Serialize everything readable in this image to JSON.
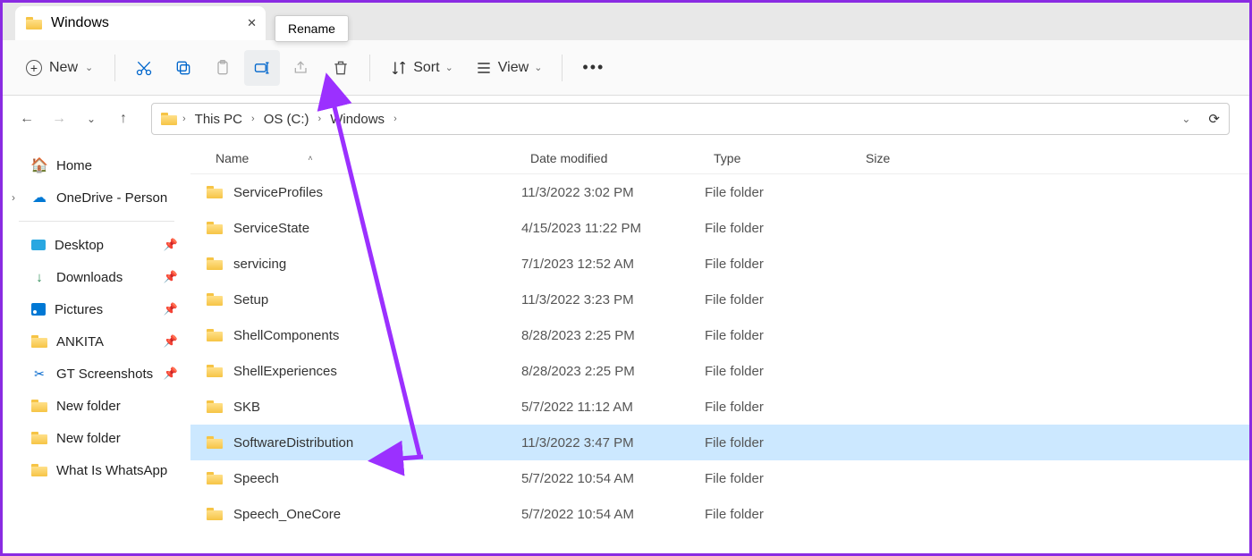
{
  "tab": {
    "title": "Windows"
  },
  "tooltip": "Rename",
  "toolbar": {
    "new": "New",
    "sort": "Sort",
    "view": "View"
  },
  "breadcrumbs": [
    "This PC",
    "OS (C:)",
    "Windows"
  ],
  "columns": {
    "name": "Name",
    "date": "Date modified",
    "type": "Type",
    "size": "Size"
  },
  "quick": {
    "home": "Home",
    "onedrive": "OneDrive - Person",
    "items": [
      {
        "label": "Desktop",
        "icon": "desktop",
        "pin": true
      },
      {
        "label": "Downloads",
        "icon": "download",
        "pin": true
      },
      {
        "label": "Pictures",
        "icon": "pictures",
        "pin": true
      },
      {
        "label": "ANKITA",
        "icon": "folder",
        "pin": true
      },
      {
        "label": "GT Screenshots",
        "icon": "scissors",
        "pin": true
      },
      {
        "label": "New folder",
        "icon": "folder",
        "pin": false
      },
      {
        "label": "New folder",
        "icon": "folder",
        "pin": false
      },
      {
        "label": "What Is WhatsApp",
        "icon": "folder",
        "pin": false
      }
    ]
  },
  "rows": [
    {
      "name": "ServiceProfiles",
      "date": "11/3/2022 3:02 PM",
      "type": "File folder",
      "selected": false
    },
    {
      "name": "ServiceState",
      "date": "4/15/2023 11:22 PM",
      "type": "File folder",
      "selected": false
    },
    {
      "name": "servicing",
      "date": "7/1/2023 12:52 AM",
      "type": "File folder",
      "selected": false
    },
    {
      "name": "Setup",
      "date": "11/3/2022 3:23 PM",
      "type": "File folder",
      "selected": false
    },
    {
      "name": "ShellComponents",
      "date": "8/28/2023 2:25 PM",
      "type": "File folder",
      "selected": false
    },
    {
      "name": "ShellExperiences",
      "date": "8/28/2023 2:25 PM",
      "type": "File folder",
      "selected": false
    },
    {
      "name": "SKB",
      "date": "5/7/2022 11:12 AM",
      "type": "File folder",
      "selected": false
    },
    {
      "name": "SoftwareDistribution",
      "date": "11/3/2022 3:47 PM",
      "type": "File folder",
      "selected": true
    },
    {
      "name": "Speech",
      "date": "5/7/2022 10:54 AM",
      "type": "File folder",
      "selected": false
    },
    {
      "name": "Speech_OneCore",
      "date": "5/7/2022 10:54 AM",
      "type": "File folder",
      "selected": false
    }
  ]
}
